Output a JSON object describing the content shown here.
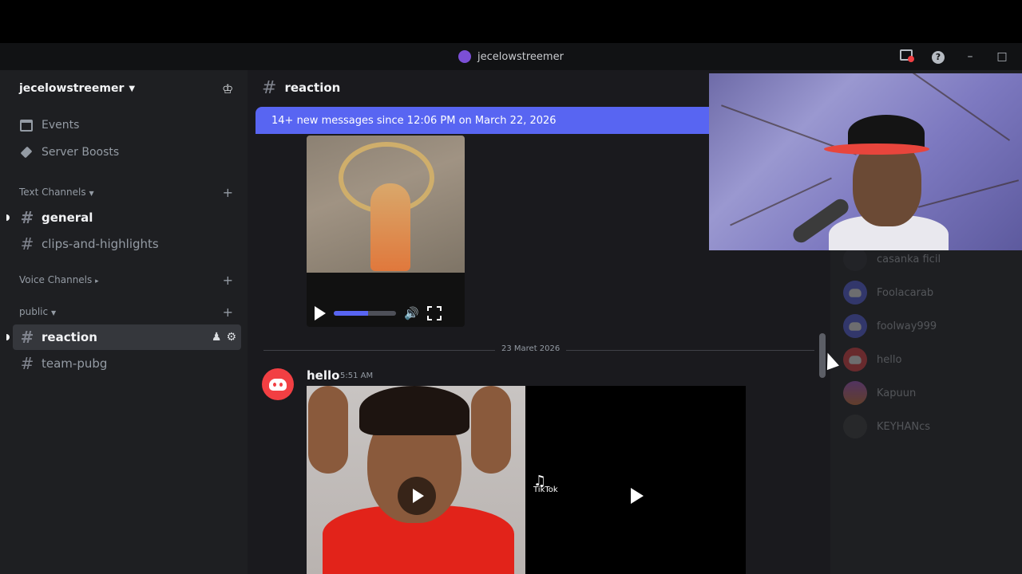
{
  "window": {
    "title": "jecelowstreemer"
  },
  "sidebar": {
    "server_name": "jecelowstreemer",
    "nav": [
      {
        "label": "Events",
        "icon": "calendar-icon"
      },
      {
        "label": "Server Boosts",
        "icon": "boost-icon"
      }
    ],
    "categories": {
      "text": "Text Channels",
      "voice": "Voice Channels",
      "public": "public"
    },
    "text_channels": [
      "general",
      "clips-and-highlights"
    ],
    "public_channels": [
      "reaction",
      "team-pubg"
    ]
  },
  "chat": {
    "channel": "reaction",
    "new_messages_banner": "14+ new messages since 12:06 PM on March 22, 2026",
    "video_progress": 0.55,
    "date_divider": "23 Maret 2026",
    "message": {
      "author": "hello",
      "time": "5:51 AM",
      "tiktok_label": "TikTok"
    }
  },
  "members": [
    "casanka ficil",
    "Foolacarab",
    "foolway999",
    "hello",
    "Kapuun",
    "KEYHANcs"
  ],
  "colors": {
    "accent": "#5865f2",
    "danger": "#f23f43"
  }
}
